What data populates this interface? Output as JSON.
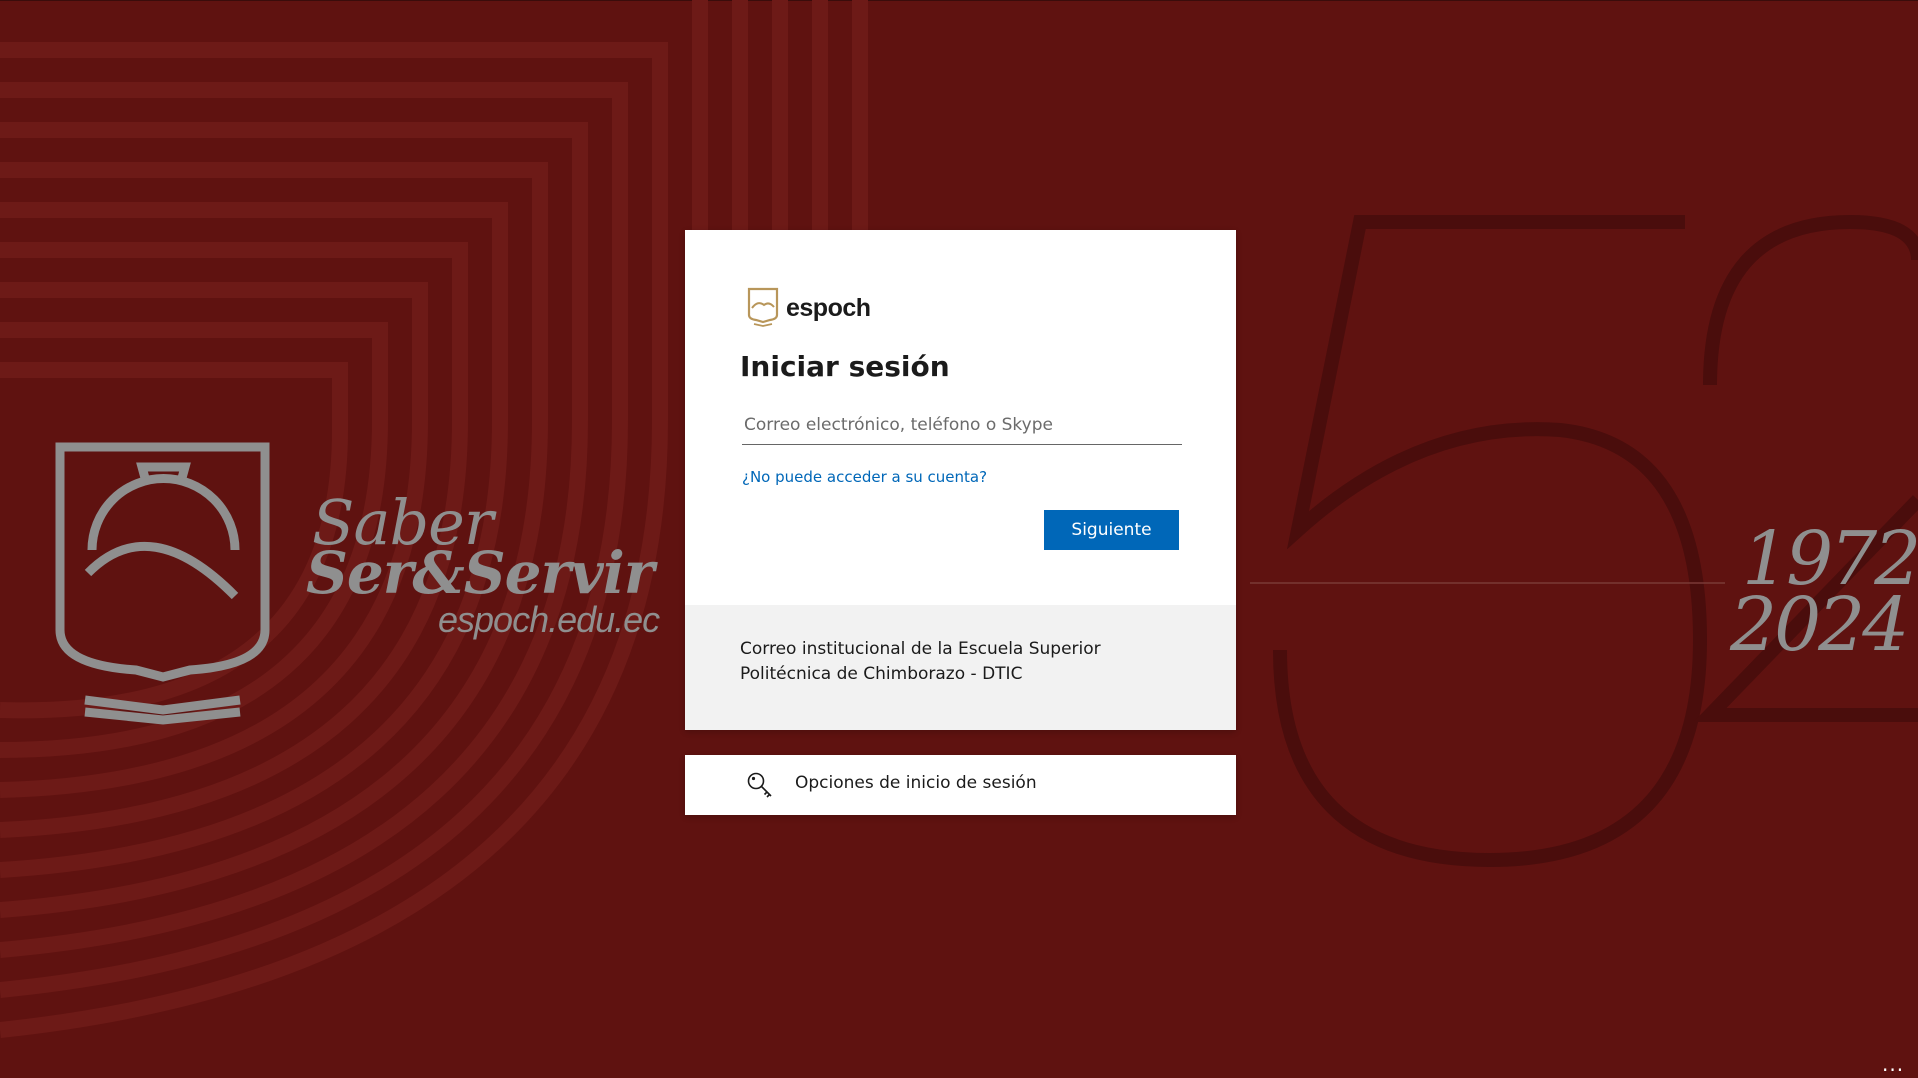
{
  "background": {
    "color": "#5f1210",
    "pattern_color": "#6d1a17",
    "motto_line1": "Saber",
    "motto_line2": "Ser&Servir",
    "website": "espoch.edu.ec",
    "year_start": "1972",
    "year_end": "2024",
    "shield_icon": "espoch-shield-icon",
    "numeral_icon": "52-anniversary-outline-icon"
  },
  "card": {
    "logo_icon": "espoch-mountain-logo-icon",
    "logo_text": "espoch",
    "title": "Iniciar sesión",
    "email_placeholder": "Correo electrónico, teléfono o Skype",
    "email_value": "",
    "cant_access_link": "¿No puede acceder a su cuenta?",
    "next_button": "Siguiente",
    "footer_text": "Correo institucional de la Escuela Superior Politécnica de Chimborazo - DTIC",
    "accent_color": "#0067b8"
  },
  "sign_in_options": {
    "icon": "key-search-icon",
    "label": "Opciones de inicio de sesión"
  },
  "more_options": {
    "label": "..."
  }
}
